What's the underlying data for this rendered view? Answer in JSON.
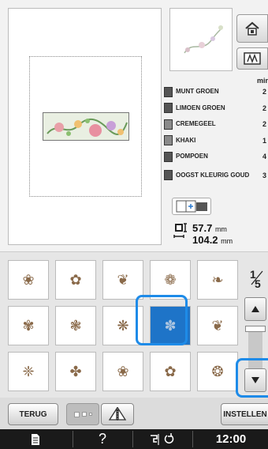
{
  "preview": {
    "icon": "floral-design-preview"
  },
  "header_buttons": {
    "home_icon": "home-icon",
    "thread_icon": "thread-color-icon"
  },
  "color_list": {
    "min_label": "min",
    "colors": [
      {
        "name": "MUNT GROEN",
        "minutes": "2"
      },
      {
        "name": "LIMOEN GROEN",
        "minutes": "2"
      },
      {
        "name": "CREMEGEEL",
        "minutes": "2"
      },
      {
        "name": "KHAKI",
        "minutes": "1"
      },
      {
        "name": "POMPOEN",
        "minutes": "4"
      },
      {
        "name": "OOGST KLEURIG GOUD",
        "minutes": "3"
      }
    ]
  },
  "size": {
    "width_value": "57.7",
    "height_value": "104.2",
    "unit": "mm"
  },
  "grid": {
    "page_current": "1",
    "page_total": "5",
    "patterns": [
      {
        "icon": "embroidery-pattern-icon",
        "glyph": "❀"
      },
      {
        "icon": "embroidery-pattern-icon",
        "glyph": "✿"
      },
      {
        "icon": "embroidery-pattern-icon",
        "glyph": "❦"
      },
      {
        "icon": "embroidery-pattern-icon",
        "glyph": "❁"
      },
      {
        "icon": "embroidery-pattern-icon",
        "glyph": "❧"
      },
      {
        "icon": "embroidery-pattern-icon",
        "glyph": "✾"
      },
      {
        "icon": "embroidery-pattern-icon",
        "glyph": "❃"
      },
      {
        "icon": "embroidery-pattern-icon",
        "glyph": "❋"
      },
      {
        "icon": "embroidery-pattern-icon",
        "glyph": "✽"
      },
      {
        "icon": "embroidery-pattern-icon",
        "glyph": "❦"
      },
      {
        "icon": "embroidery-pattern-icon",
        "glyph": "❈"
      },
      {
        "icon": "embroidery-pattern-icon",
        "glyph": "✤"
      },
      {
        "icon": "embroidery-pattern-icon",
        "glyph": "❀"
      },
      {
        "icon": "embroidery-pattern-icon",
        "glyph": "✿"
      },
      {
        "icon": "embroidery-pattern-icon",
        "glyph": "❂"
      }
    ]
  },
  "buttons": {
    "back_label": "TERUG",
    "set_label": "INSTELLEN"
  },
  "status_bar": {
    "time": "12:00",
    "help_label": "?"
  },
  "colors": {
    "accent": "#1e8be8",
    "selected_bg": "#1e74c8"
  }
}
